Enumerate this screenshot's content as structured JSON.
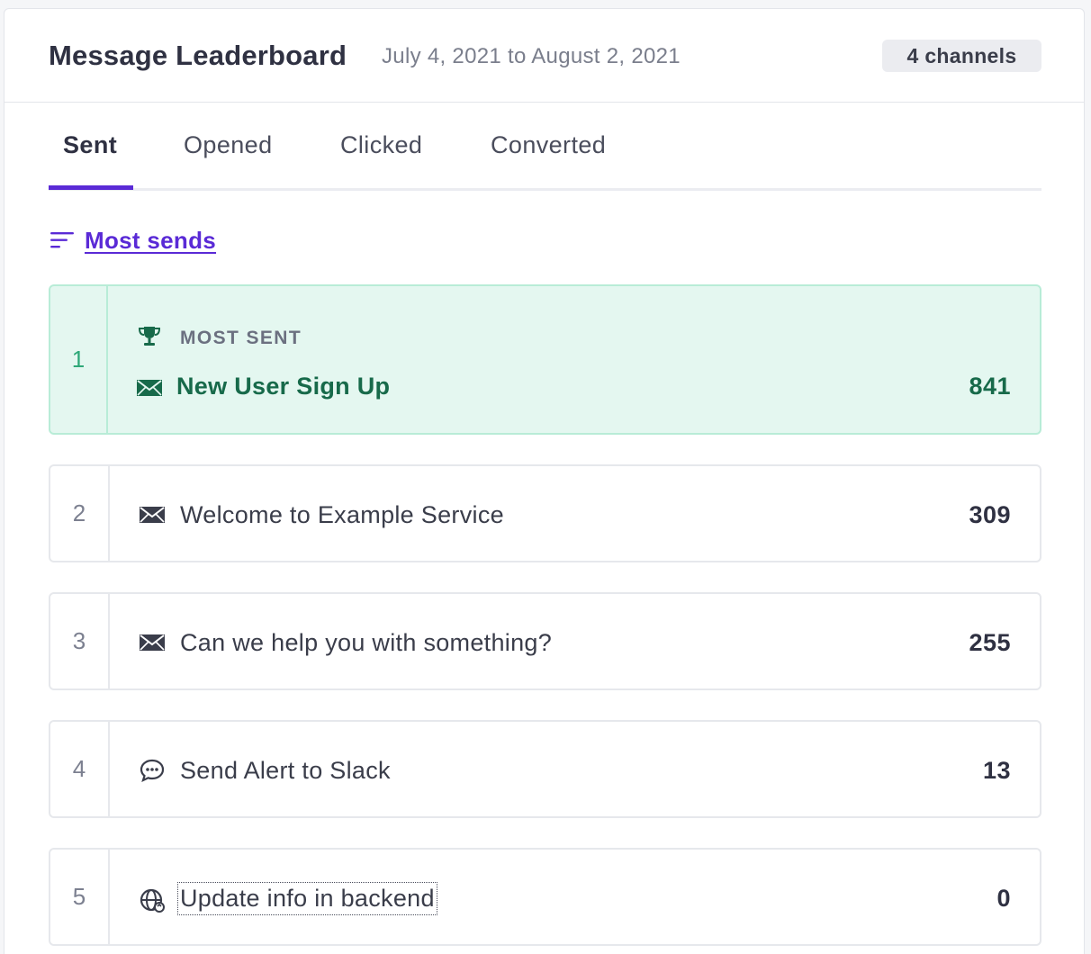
{
  "header": {
    "title": "Message Leaderboard",
    "date_range": "July 4, 2021 to August 2, 2021",
    "channels_badge": "4 channels"
  },
  "tabs": [
    {
      "label": "Sent",
      "active": true
    },
    {
      "label": "Opened",
      "active": false
    },
    {
      "label": "Clicked",
      "active": false
    },
    {
      "label": "Converted",
      "active": false
    }
  ],
  "sort": {
    "label": "Most sends",
    "icon": "sort-lines-icon"
  },
  "top_award": {
    "label": "MOST SENT",
    "icon": "trophy-icon"
  },
  "rows": [
    {
      "rank": "1",
      "icon": "envelope-icon",
      "name": "New User Sign Up",
      "count": "841"
    },
    {
      "rank": "2",
      "icon": "envelope-icon",
      "name": "Welcome to Example Service",
      "count": "309"
    },
    {
      "rank": "3",
      "icon": "envelope-icon",
      "name": "Can we help you with something?",
      "count": "255"
    },
    {
      "rank": "4",
      "icon": "chat-bubble-icon",
      "name": "Send Alert to Slack",
      "count": "13"
    },
    {
      "rank": "5",
      "icon": "globe-sync-icon",
      "name": "Update info in backend",
      "count": "0"
    }
  ],
  "colors": {
    "accent": "#5a2ad6",
    "top_row_bg": "#e4f7f0",
    "top_row_text": "#176a4a",
    "top_row_rank": "#2ea878"
  }
}
